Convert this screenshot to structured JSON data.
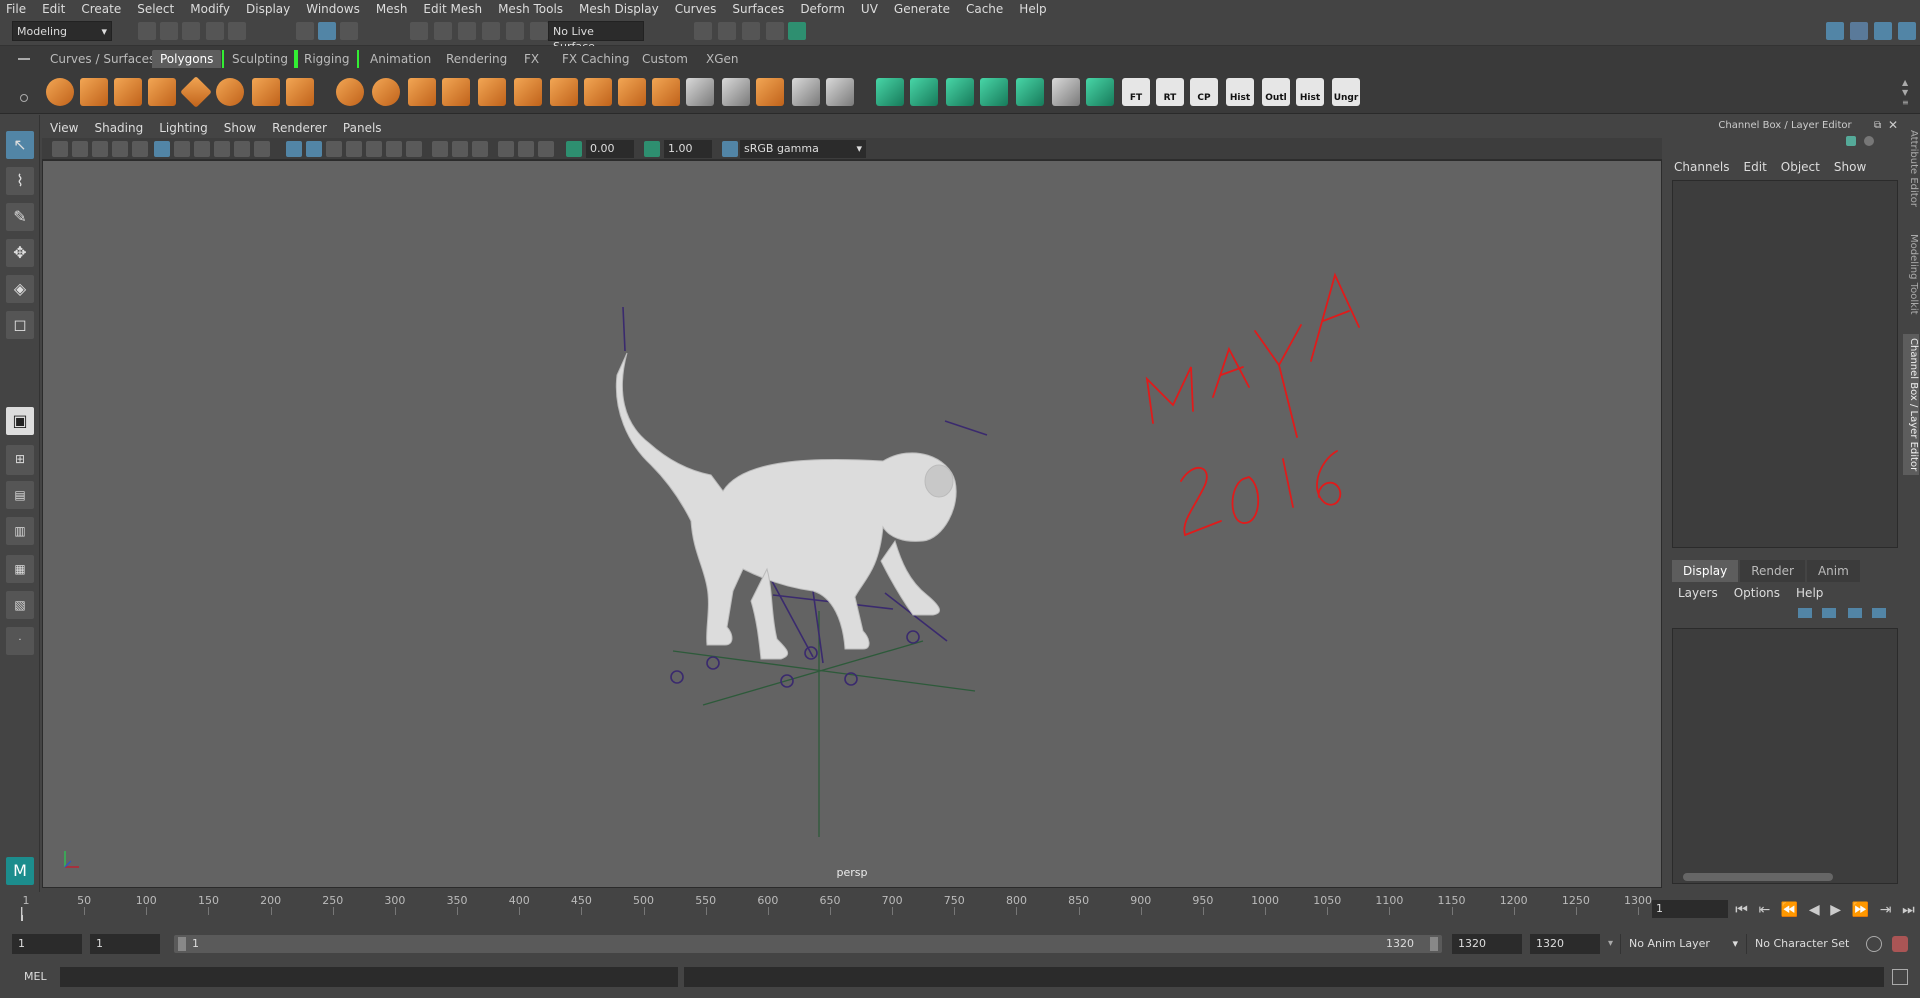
{
  "menubar": [
    "File",
    "Edit",
    "Create",
    "Select",
    "Modify",
    "Display",
    "Windows",
    "Mesh",
    "Edit Mesh",
    "Mesh Tools",
    "Mesh Display",
    "Curves",
    "Surfaces",
    "Deform",
    "UV",
    "Generate",
    "Cache",
    "Help"
  ],
  "status": {
    "mode": "Modeling",
    "live_surface": "No Live Surface"
  },
  "shelf_tabs": [
    "Curves / Surfaces",
    "Polygons",
    "Sculpting",
    "Rigging",
    "Animation",
    "Rendering",
    "FX",
    "FX Caching",
    "Custom",
    "XGen"
  ],
  "shelf_active": "Polygons",
  "shelf_labels": [
    "FT",
    "RT",
    "CP",
    "Hist",
    "Outl",
    "Hist",
    "Ungr"
  ],
  "view_menu": [
    "View",
    "Shading",
    "Lighting",
    "Show",
    "Renderer",
    "Panels"
  ],
  "viewport": {
    "near": "0.00",
    "far": "1.00",
    "colorspace": "sRGB gamma",
    "camera": "persp"
  },
  "annotation": {
    "line1": "MAYA",
    "line2": "2016",
    "color": "#e01b1b"
  },
  "right_panel": {
    "title": "Channel Box / Layer Editor",
    "menu": [
      "Channels",
      "Edit",
      "Object",
      "Show"
    ],
    "tabs": [
      "Display",
      "Render",
      "Anim"
    ],
    "layer_menu": [
      "Layers",
      "Options",
      "Help"
    ]
  },
  "side_tabs": [
    "Attribute Editor",
    "Modeling Toolkit",
    "Channel Box / Layer Editor"
  ],
  "timeline": {
    "ticks": [
      "1",
      "50",
      "100",
      "150",
      "200",
      "250",
      "300",
      "350",
      "400",
      "450",
      "500",
      "550",
      "600",
      "650",
      "700",
      "750",
      "800",
      "850",
      "900",
      "950",
      "1000",
      "1050",
      "1100",
      "1150",
      "1200",
      "1250",
      "1300"
    ],
    "current": "1"
  },
  "range": {
    "start": "1",
    "start2": "1",
    "slider_start": "1",
    "slider_end": "1320",
    "end": "1320",
    "end2": "1320",
    "anim_layer": "No Anim Layer",
    "char_set": "No Character Set"
  },
  "cmd": {
    "label": "MEL"
  }
}
